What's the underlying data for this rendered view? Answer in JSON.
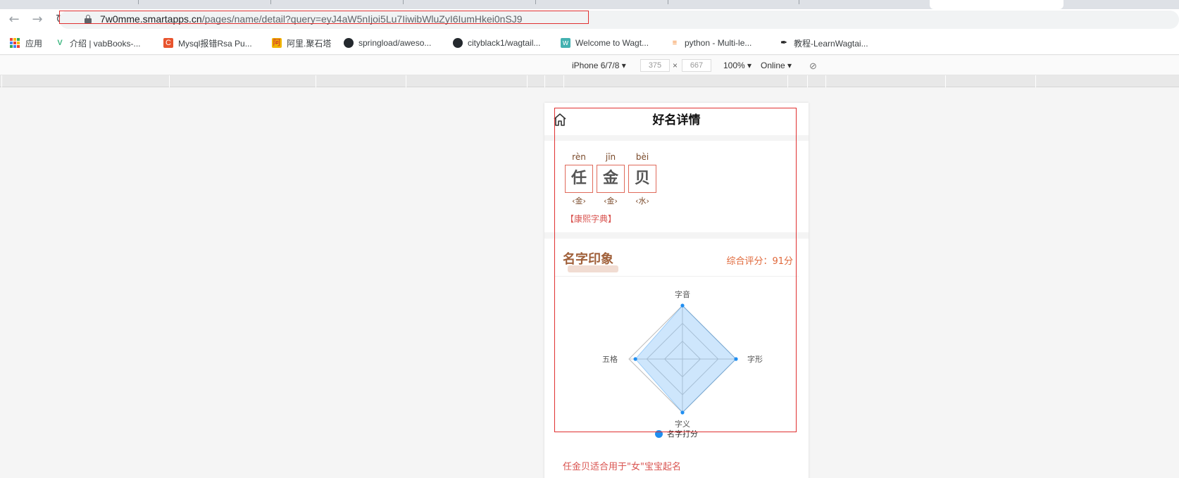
{
  "browser": {
    "url_host": "7w0mme.smartapps.cn",
    "url_path": "/pages/name/detail?query=eyJ4aW5nIjoi5Lu7IiwibWluZyI6IumHkei0nSJ9"
  },
  "bookmarks": [
    {
      "label": "应用",
      "icon": "apps-grid-icon"
    },
    {
      "label": "介绍 | vabBooks-...",
      "icon": "vue-icon",
      "color": "#41b883"
    },
    {
      "label": "Mysql报错Rsa Pu...",
      "icon": "c-icon",
      "color": "#e8542e"
    },
    {
      "label": "阿里.聚石塔",
      "icon": "aliyun-icon",
      "color": "#f0b400"
    },
    {
      "label": "springload/aweso...",
      "icon": "github-icon"
    },
    {
      "label": "cityblack1/wagtail...",
      "icon": "github-icon"
    },
    {
      "label": "Welcome to Wagt...",
      "icon": "wagtail-icon",
      "color": "#43b1b0"
    },
    {
      "label": "python - Multi-le...",
      "icon": "stackoverflow-icon",
      "color": "#f48024"
    },
    {
      "label": "教程-LearnWagtai...",
      "icon": "feather-icon"
    }
  ],
  "devtools": {
    "device": "iPhone 6/7/8",
    "width": "375",
    "height": "667",
    "zoom": "100%",
    "network": "Online"
  },
  "page": {
    "title": "好名详情",
    "chars": [
      {
        "pinyin": "rèn",
        "char": "任",
        "wuxing": "‹金›"
      },
      {
        "pinyin": "jīn",
        "char": "金",
        "wuxing": "‹金›"
      },
      {
        "pinyin": "bèi",
        "char": "贝",
        "wuxing": "‹水›"
      }
    ],
    "kangxi": "【康熙字典】",
    "impression_title": "名字印象",
    "score": "综合评分：91分",
    "suitable": "任金贝适合用于\"女\"宝宝起名"
  },
  "chart_data": {
    "type": "radar",
    "categories": [
      "字音",
      "字形",
      "字义",
      "五格"
    ],
    "series": [
      {
        "name": "名字打分",
        "values": [
          100,
          100,
          100,
          88
        ]
      }
    ],
    "range": [
      0,
      100
    ],
    "color": "#1f8ef1"
  }
}
